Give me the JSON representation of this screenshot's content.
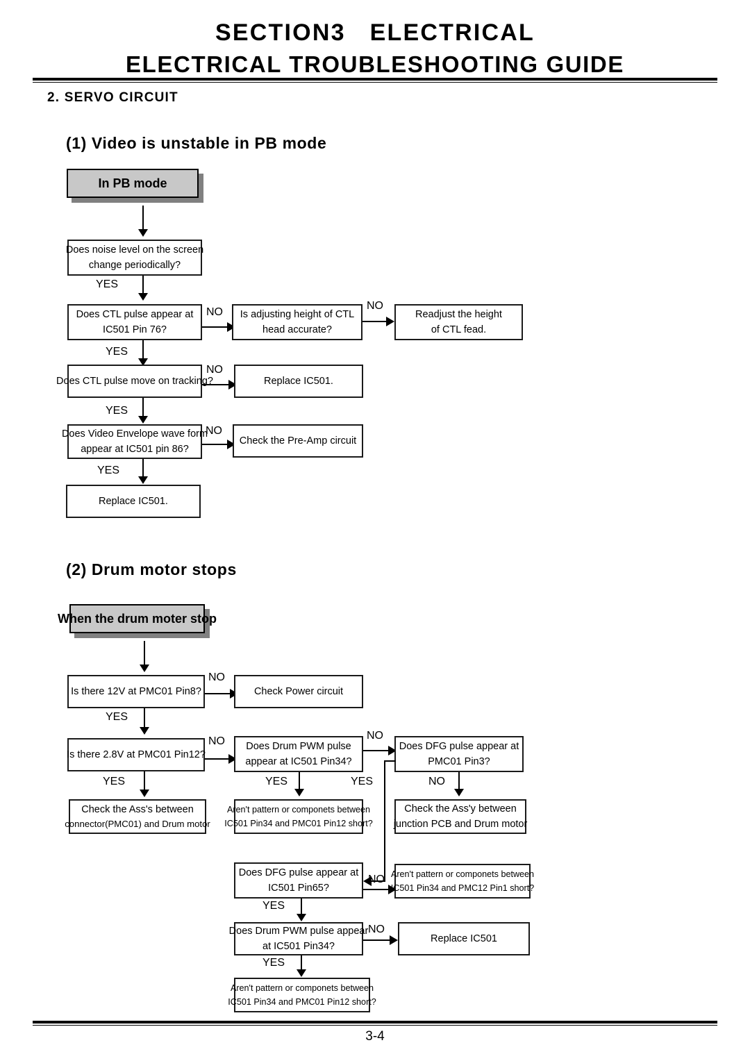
{
  "header": {
    "line1": "SECTION3   ELECTRICAL",
    "line2": "ELECTRICAL TROUBLESHOOTING GUIDE",
    "section_heading": "2. SERVO CIRCUIT"
  },
  "footer": {
    "page_number": "3-4"
  },
  "flow1": {
    "subheading": "(1) Video is unstable in PB mode",
    "start": "In PB mode",
    "boxes": {
      "noise_l1": "Does noise level on the screen",
      "noise_l2": "change periodically?",
      "ctl_appear_l1": "Does CTL pulse appear at",
      "ctl_appear_l2": "IC501 Pin 76?",
      "ctl_height_l1": "Is adjusting height of CTL",
      "ctl_height_l2": "head accurate?",
      "readjust_l1": "Readjust the height",
      "readjust_l2": "of CTL fead.",
      "ctl_tracking": "Does CTL pulse move on tracking?",
      "replace_1": "Replace IC501.",
      "envelope_l1": "Does Video Envelope wave form",
      "envelope_l2": "appear at IC501 pin 86?",
      "preamp": "Check the Pre-Amp circuit",
      "replace_2": "Replace IC501."
    },
    "labels": {
      "yes1": "YES",
      "yes2": "YES",
      "yes3": "YES",
      "yes4": "YES",
      "no1": "NO",
      "no2": "NO",
      "no3": "NO",
      "no4": "NO"
    }
  },
  "flow2": {
    "subheading": "(2) Drum motor stops",
    "start": "When the drum moter stop",
    "boxes": {
      "v12": "Is there 12V at PMC01 Pin8?",
      "power": "Check Power circuit",
      "v28": "Is there 2.8V at PMC01 Pin12?",
      "pwm_a_l1": "Does Drum PWM pulse",
      "pwm_a_l2": "appear at IC501 Pin34?",
      "dfg_pmc_l1": "Does DFG pulse appear at",
      "dfg_pmc_l2": "PMC01 Pin3?",
      "ass_conn_l1": "Check the Ass's between",
      "ass_conn_l2": "connector(PMC01) and Drum motor",
      "pattern_a_l1": "Aren't pattern or componets between",
      "pattern_a_l2": "IC501 Pin34 and PMC01 Pin12 short?",
      "ass_junc_l1": "Check the Ass'y between",
      "ass_junc_l2": "junction PCB and Drum motor",
      "dfg_ic_l1": "Does DFG pulse appear at",
      "dfg_ic_l2": "IC501 Pin65?",
      "pattern_b_l1": "Aren't pattern or componets between",
      "pattern_b_l2": "IC501 Pin34 and PMC12 Pin1 short?",
      "pwm_b_l1": "Does Drum PWM pulse appear",
      "pwm_b_l2": "at IC501 Pin34?",
      "replace": "Replace IC501",
      "pattern_c_l1": "Aren't pattern or componets between",
      "pattern_c_l2": "IC501 Pin34 and PMC01 Pin12 short?"
    },
    "labels": {
      "no1": "NO",
      "no2": "NO",
      "no3": "NO",
      "no4": "NO",
      "no5": "NO",
      "no6": "NO",
      "yes1": "YES",
      "yes2": "YES",
      "yes3": "YES",
      "yes4": "YES",
      "yes5": "YES"
    }
  },
  "colors": {
    "ink": "#000000",
    "start_fill": "#c8c8c8",
    "start_shadow": "#808080",
    "paper": "#ffffff"
  }
}
